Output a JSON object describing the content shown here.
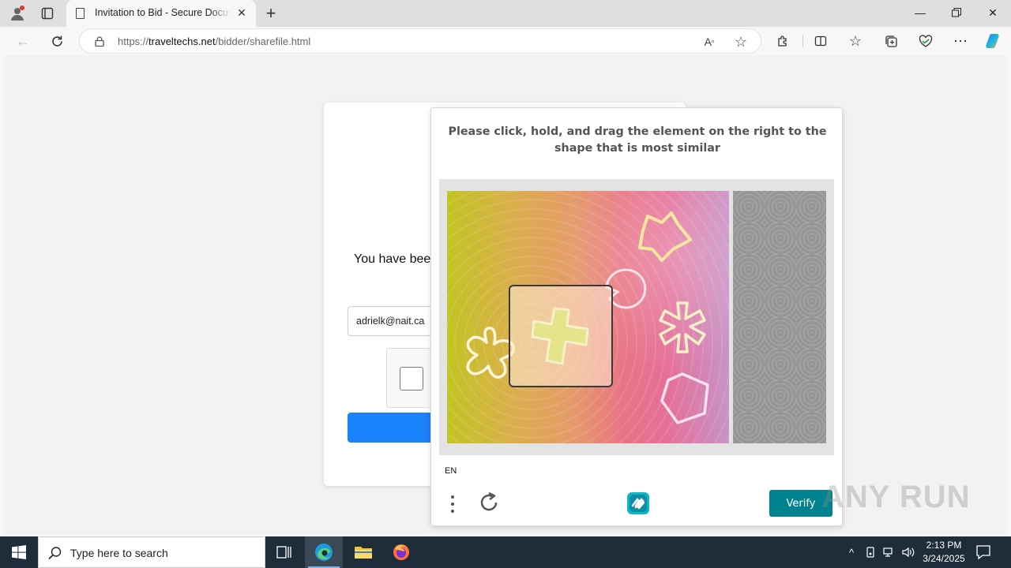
{
  "browser": {
    "tab": {
      "title": "Invitation to Bid - Secure Document"
    },
    "url": {
      "domain": "traveltechs.net",
      "path": "/bidder/sharefile.html",
      "prefix": "https://"
    }
  },
  "page": {
    "invited_text": "You have been",
    "email_value": "adrielk@nait.ca"
  },
  "captcha": {
    "prompt": "Please click, hold, and drag the element on the right to the shape that is most similar",
    "language": "EN",
    "verify_label": "Verify",
    "accent_color": "#00838f"
  },
  "watermark": "ANY RUN",
  "taskbar": {
    "search_placeholder": "Type here to search",
    "time": "2:13 PM",
    "date": "3/24/2025"
  },
  "icons": {
    "browser": [
      "profile-icon",
      "tab-actions-icon",
      "page-icon",
      "close-tab-icon",
      "new-tab-icon",
      "minimize-icon",
      "restore-icon",
      "close-window-icon",
      "back-icon",
      "refresh-icon",
      "lock-icon",
      "read-aloud-icon",
      "favorite-star-icon",
      "extensions-icon",
      "split-screen-icon",
      "favorites-icon",
      "collections-icon",
      "browser-essentials-icon",
      "more-icon",
      "copilot-icon"
    ],
    "captcha_shapes": [
      "cross-shape",
      "star-shape",
      "pentagon-shape",
      "circle-shape",
      "asterisk-shape",
      "blob-shape"
    ]
  }
}
